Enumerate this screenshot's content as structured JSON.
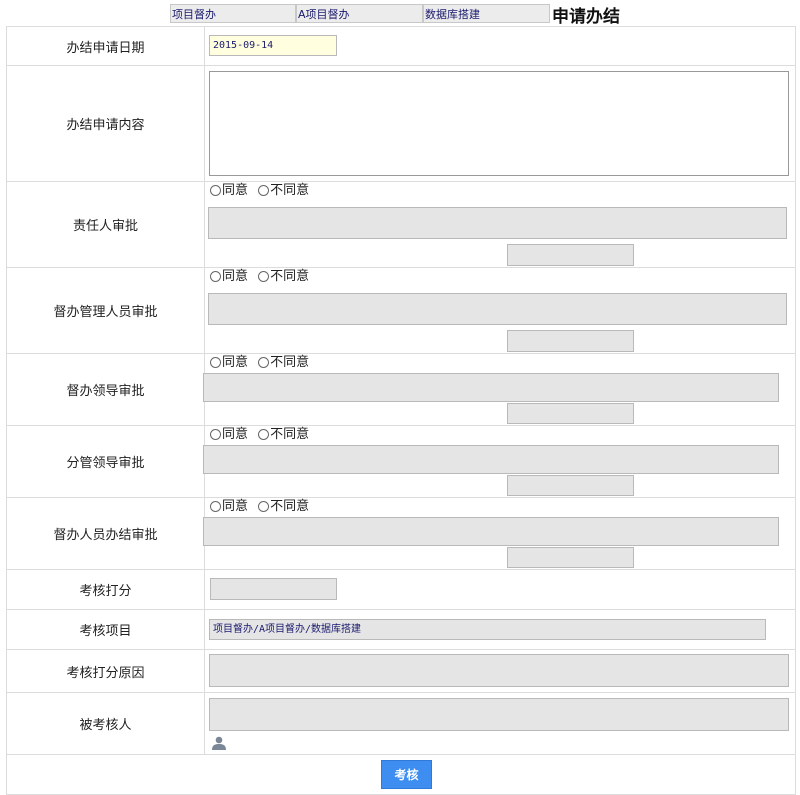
{
  "breadcrumbs": [
    "项目督办",
    "A项目督办",
    "数据库搭建"
  ],
  "page_title": "申请办结",
  "rows": {
    "apply_date": {
      "label": "办结申请日期",
      "value": "2015-09-14"
    },
    "apply_content": {
      "label": "办结申请内容",
      "value": ""
    },
    "responsible": {
      "label": "责任人审批"
    },
    "supervisor_mgr": {
      "label": "督办管理人员审批"
    },
    "supervisor_leader": {
      "label": "督办领导审批"
    },
    "division_leader": {
      "label": "分管领导审批"
    },
    "supervisor_close": {
      "label": "督办人员办结审批"
    },
    "score": {
      "label": "考核打分",
      "value": ""
    },
    "items": {
      "label": "考核项目",
      "value": "项目督办/A项目督办/数据库搭建"
    },
    "score_reason": {
      "label": "考核打分原因",
      "value": ""
    },
    "assessee": {
      "label": "被考核人",
      "value": ""
    }
  },
  "radio": {
    "agree": "同意",
    "disagree": "不同意"
  },
  "icons": {
    "person": "person-icon"
  },
  "submit_label": "考核",
  "colors": {
    "button": "#3d8ef0",
    "date_field": "#ffffe0",
    "readonly_field": "#e5e5e5"
  }
}
